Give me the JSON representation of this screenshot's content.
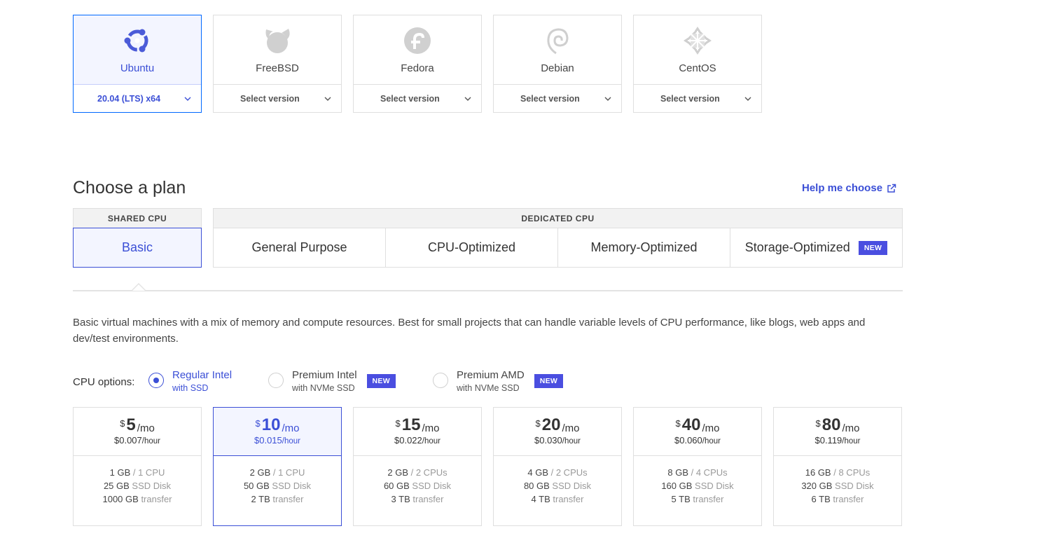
{
  "os": [
    {
      "name": "Ubuntu",
      "version": "20.04 (LTS) x64",
      "selected": true,
      "icon": "ubuntu-logo-icon"
    },
    {
      "name": "FreeBSD",
      "version": "Select version",
      "selected": false,
      "icon": "freebsd-logo-icon"
    },
    {
      "name": "Fedora",
      "version": "Select version",
      "selected": false,
      "icon": "fedora-logo-icon"
    },
    {
      "name": "Debian",
      "version": "Select version",
      "selected": false,
      "icon": "debian-logo-icon"
    },
    {
      "name": "CentOS",
      "version": "Select version",
      "selected": false,
      "icon": "centos-logo-icon"
    }
  ],
  "plan": {
    "title": "Choose a plan",
    "help_link": "Help me choose",
    "shared_header": "SHARED CPU",
    "basic_label": "Basic",
    "dedicated_header": "DEDICATED CPU",
    "dedicated_tabs": [
      {
        "label": "General Purpose",
        "badge": ""
      },
      {
        "label": "CPU-Optimized",
        "badge": ""
      },
      {
        "label": "Memory-Optimized",
        "badge": ""
      },
      {
        "label": "Storage-Optimized",
        "badge": "NEW"
      }
    ],
    "description": "Basic virtual machines with a mix of memory and compute resources. Best for small projects that can handle variable levels of CPU performance, like blogs, web apps and dev/test environments."
  },
  "cpu_options": {
    "label": "CPU options:",
    "options": [
      {
        "main": "Regular Intel",
        "sub": "with SSD",
        "selected": true,
        "badge": ""
      },
      {
        "main": "Premium Intel",
        "sub": "with NVMe SSD",
        "selected": false,
        "badge": "NEW"
      },
      {
        "main": "Premium AMD",
        "sub": "with NVMe SSD",
        "selected": false,
        "badge": "NEW"
      }
    ]
  },
  "prices": [
    {
      "currency": "$",
      "amount": "5",
      "per": "/mo",
      "hourly": "$0.007",
      "hour_unit": "/hour",
      "mem": "1 GB",
      "cpu": "/ 1 CPU",
      "disk": "25 GB",
      "disk_unit": "SSD Disk",
      "transfer": "1000 GB",
      "transfer_unit": "transfer",
      "selected": false
    },
    {
      "currency": "$",
      "amount": "10",
      "per": "/mo",
      "hourly": "$0.015",
      "hour_unit": "/hour",
      "mem": "2 GB",
      "cpu": "/ 1 CPU",
      "disk": "50 GB",
      "disk_unit": "SSD Disk",
      "transfer": "2 TB",
      "transfer_unit": "transfer",
      "selected": true
    },
    {
      "currency": "$",
      "amount": "15",
      "per": "/mo",
      "hourly": "$0.022",
      "hour_unit": "/hour",
      "mem": "2 GB",
      "cpu": "/ 2 CPUs",
      "disk": "60 GB",
      "disk_unit": "SSD Disk",
      "transfer": "3 TB",
      "transfer_unit": "transfer",
      "selected": false
    },
    {
      "currency": "$",
      "amount": "20",
      "per": "/mo",
      "hourly": "$0.030",
      "hour_unit": "/hour",
      "mem": "4 GB",
      "cpu": "/ 2 CPUs",
      "disk": "80 GB",
      "disk_unit": "SSD Disk",
      "transfer": "4 TB",
      "transfer_unit": "transfer",
      "selected": false
    },
    {
      "currency": "$",
      "amount": "40",
      "per": "/mo",
      "hourly": "$0.060",
      "hour_unit": "/hour",
      "mem": "8 GB",
      "cpu": "/ 4 CPUs",
      "disk": "160 GB",
      "disk_unit": "SSD Disk",
      "transfer": "5 TB",
      "transfer_unit": "transfer",
      "selected": false
    },
    {
      "currency": "$",
      "amount": "80",
      "per": "/mo",
      "hourly": "$0.119",
      "hour_unit": "/hour",
      "mem": "16 GB",
      "cpu": "/ 8 CPUs",
      "disk": "320 GB",
      "disk_unit": "SSD Disk",
      "transfer": "6 TB",
      "transfer_unit": "transfer",
      "selected": false
    }
  ],
  "colors": {
    "accent": "#3b4fd6",
    "badge": "#4a4ee0",
    "border": "#dfdfdf"
  }
}
